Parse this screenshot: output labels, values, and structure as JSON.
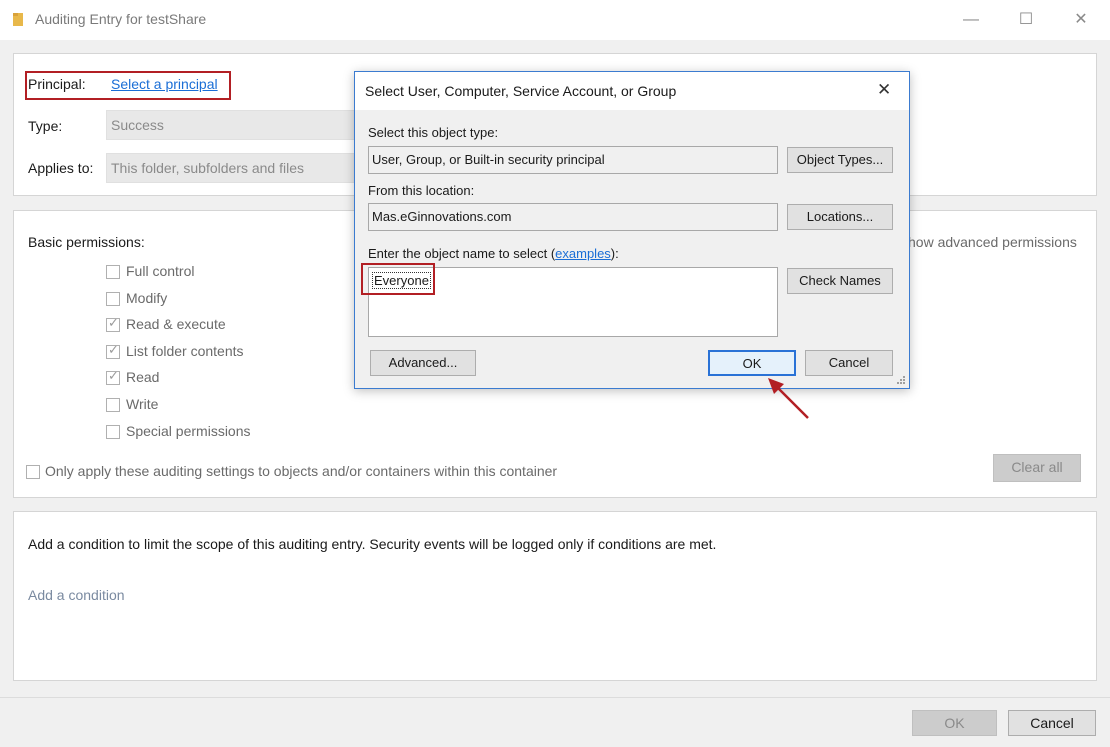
{
  "window": {
    "title": "Auditing Entry for testShare",
    "minimize": "—",
    "maximize": "☐",
    "close": "✕"
  },
  "principal": {
    "label": "Principal:",
    "link": "Select a principal"
  },
  "type": {
    "label": "Type:",
    "value": "Success"
  },
  "applies_to": {
    "label": "Applies to:",
    "value": "This folder, subfolders and files"
  },
  "permissions": {
    "heading": "Basic permissions:",
    "show_advanced": "how advanced permissions",
    "items": [
      {
        "label": "Full control",
        "checked": false
      },
      {
        "label": "Modify",
        "checked": false
      },
      {
        "label": "Read & execute",
        "checked": true
      },
      {
        "label": "List folder contents",
        "checked": true
      },
      {
        "label": "Read",
        "checked": true
      },
      {
        "label": "Write",
        "checked": false
      },
      {
        "label": "Special permissions",
        "checked": false
      }
    ],
    "only_apply": "Only apply these auditing settings to objects and/or containers within this container",
    "clear_all": "Clear all"
  },
  "condition": {
    "text": "Add a condition to limit the scope of this auditing entry. Security events will be logged only if conditions are met.",
    "add_link": "Add a condition"
  },
  "footer": {
    "ok": "OK",
    "cancel": "Cancel"
  },
  "dialog": {
    "title": "Select User, Computer, Service Account, or Group",
    "close": "✕",
    "object_type_label": "Select this object type:",
    "object_type_value": "User, Group, or Built-in security principal",
    "object_types_button": "Object Types...",
    "location_label": "From this location:",
    "location_value": "Mas.eGinnovations.com",
    "locations_button": "Locations...",
    "object_name_label_prefix": "Enter the object name to select (",
    "object_name_label_link": "examples",
    "object_name_label_suffix": "):",
    "object_name_value": "Everyone",
    "check_names_button": "Check Names",
    "advanced_button": "Advanced...",
    "ok_button": "OK",
    "cancel_button": "Cancel"
  },
  "colors": {
    "highlight_red": "#b21f24",
    "link_blue": "#1a6ed6",
    "dialog_border": "#3b7bd0"
  }
}
